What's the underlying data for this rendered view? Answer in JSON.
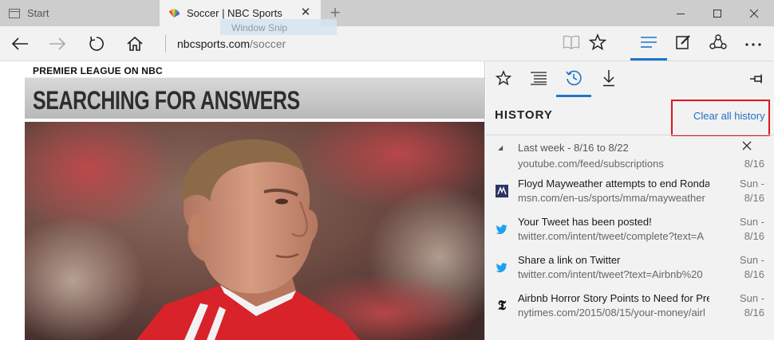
{
  "tabs": [
    {
      "title": "Start",
      "icon": "start-page-icon",
      "active": false
    },
    {
      "title": "Soccer | NBC Sports",
      "icon": "nbc-peacock-icon",
      "active": true
    }
  ],
  "ghost_tooltip": "Window Snip",
  "address": {
    "host": "nbcsports.com",
    "path": "/soccer"
  },
  "page": {
    "kicker": "PREMIER LEAGUE ON NBC",
    "headline": "SEARCHING FOR ANSWERS"
  },
  "hub": {
    "title": "HISTORY",
    "clear_label": "Clear all history",
    "group_label": "Last week - 8/16 to 8/22",
    "items": [
      {
        "title": "",
        "url": "youtube.com/feed/subscriptions",
        "day": "",
        "date": "8/16",
        "icon": "youtube-icon"
      },
      {
        "title": "Floyd Mayweather attempts to end Ronda",
        "url": "msn.com/en-us/sports/mma/mayweather",
        "day": "Sun -",
        "date": "8/16",
        "icon": "msn-icon"
      },
      {
        "title": "Your Tweet has been posted!",
        "url": "twitter.com/intent/tweet/complete?text=A",
        "day": "Sun -",
        "date": "8/16",
        "icon": "twitter-icon"
      },
      {
        "title": "Share a link on Twitter",
        "url": "twitter.com/intent/tweet?text=Airbnb%20",
        "day": "Sun -",
        "date": "8/16",
        "icon": "twitter-icon"
      },
      {
        "title": "Airbnb Horror Story Points to Need for Pre",
        "url": "nytimes.com/2015/08/15/your-money/airl",
        "day": "Sun -",
        "date": "8/16",
        "icon": "nytimes-icon"
      }
    ]
  },
  "colors": {
    "accent": "#1e76c9",
    "highlight": "#e0161f",
    "link": "#1e6fc4"
  }
}
